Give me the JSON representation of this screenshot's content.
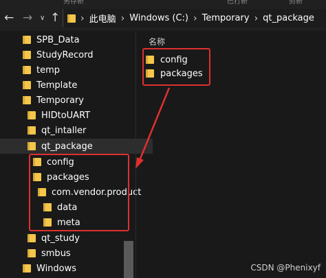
{
  "colors": {
    "accent_highlight": "#e03030",
    "folder": "#f4c64a",
    "background": "#191919"
  },
  "toolbar_top_fragments": [
    "另存新",
    "巴打新",
    "剪新"
  ],
  "nav_buttons": {
    "back_icon": "arrow-left",
    "forward_icon": "arrow-right",
    "dropdown_icon": "chevron-down",
    "up_icon": "arrow-up"
  },
  "address": {
    "crumbs": [
      "此电脑",
      "Windows (C:)",
      "Temporary",
      "qt_package"
    ],
    "separator": "›"
  },
  "nav_tree": [
    {
      "label": "SPB_Data"
    },
    {
      "label": "StudyRecord"
    },
    {
      "label": "temp"
    },
    {
      "label": "Template"
    },
    {
      "label": "Temporary"
    },
    {
      "label": "HIDtoUART"
    },
    {
      "label": "qt_intaller"
    },
    {
      "label": "qt_package",
      "selected": true
    },
    {
      "label": "config"
    },
    {
      "label": "packages"
    },
    {
      "label": "com.vendor.product"
    },
    {
      "label": "data"
    },
    {
      "label": "meta"
    },
    {
      "label": "qt_study"
    },
    {
      "label": "smbus"
    },
    {
      "label": "Windows"
    }
  ],
  "content": {
    "column_header": "名称",
    "items": [
      "config",
      "packages"
    ]
  },
  "watermark": "CSDN @Phenixyf"
}
